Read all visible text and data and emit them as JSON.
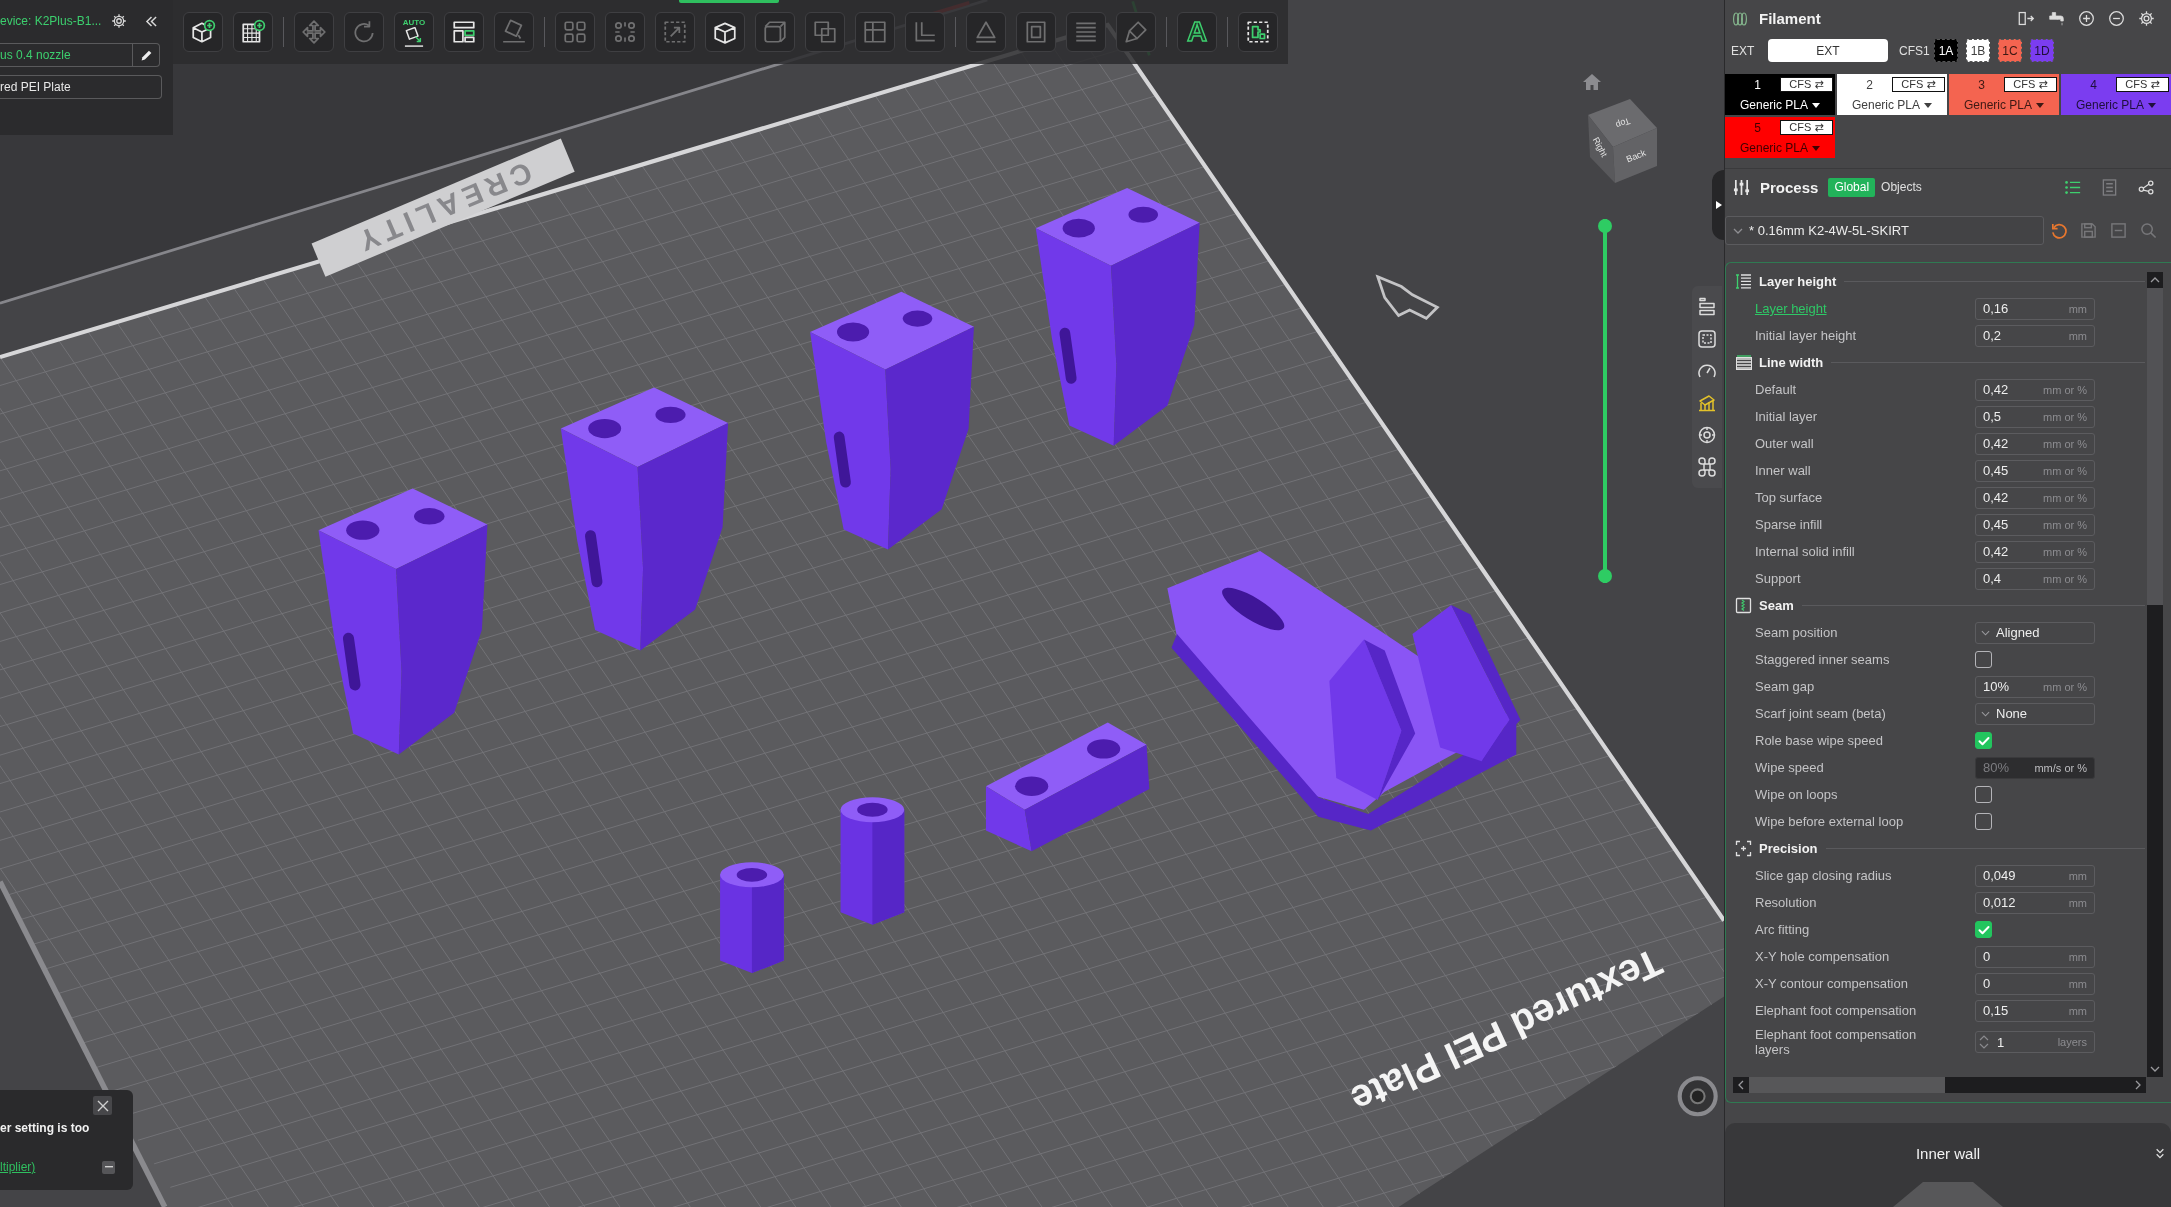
{
  "device_panel": {
    "printer": "evice: K2Plus-B1...",
    "nozzle": "us 0.4 nozzle",
    "plate": "red PEI Plate"
  },
  "toolbar_groups": [
    [
      {
        "kind": "add-model",
        "disabled": false
      },
      {
        "kind": "add-plate",
        "disabled": false
      }
    ],
    [
      {
        "kind": "move",
        "disabled": true
      },
      {
        "kind": "rotate",
        "disabled": true
      },
      {
        "kind": "auto-orient",
        "label": "AUTO",
        "disabled": false
      },
      {
        "kind": "arrange",
        "disabled": false
      },
      {
        "kind": "lay-flat",
        "disabled": true
      }
    ],
    [
      {
        "kind": "split",
        "disabled": true
      },
      {
        "kind": "dots",
        "disabled": true
      },
      {
        "kind": "scale",
        "disabled": true
      },
      {
        "kind": "box",
        "disabled": false
      },
      {
        "kind": "cube",
        "disabled": true
      },
      {
        "kind": "overlap",
        "disabled": true
      },
      {
        "kind": "quartered",
        "disabled": true
      },
      {
        "kind": "corner",
        "disabled": true
      }
    ],
    [
      {
        "kind": "cone",
        "disabled": true
      },
      {
        "kind": "nested",
        "disabled": true
      },
      {
        "kind": "stack",
        "disabled": true
      },
      {
        "kind": "brush",
        "disabled": true
      }
    ],
    [
      {
        "kind": "text",
        "glyph": "A",
        "disabled": false
      }
    ],
    [
      {
        "kind": "puzzle",
        "disabled": false
      }
    ]
  ],
  "scene": {
    "logo": "CREALITY",
    "plate_name": "Textured PEI Plate"
  },
  "view_cube": {
    "labels": [
      "Top",
      "Right",
      "Back"
    ]
  },
  "layer_slider": {
    "level": 1
  },
  "side_tools": [
    {
      "kind": "bars",
      "selected": false
    },
    {
      "kind": "frame",
      "selected": false
    },
    {
      "kind": "gauge",
      "selected": false
    },
    {
      "kind": "support",
      "selected": true
    },
    {
      "kind": "target",
      "selected": false
    },
    {
      "kind": "clover",
      "selected": false
    }
  ],
  "notification": {
    "text": "er setting is too",
    "link": "ltiplier)"
  },
  "filament": {
    "title": "Filament",
    "ext_label": "EXT",
    "ext_value": "EXT",
    "cfs_label": "CFS1",
    "cfs_slots": [
      {
        "label": "1A",
        "color": "#000000"
      },
      {
        "label": "1B",
        "color": "#ffffff"
      },
      {
        "label": "1C",
        "color": "#f46450"
      },
      {
        "label": "1D",
        "color": "#7b3df0"
      }
    ],
    "slots": [
      {
        "number": "1",
        "source": "CFS ⇄",
        "material": "Generic PLA",
        "color": "#000000"
      },
      {
        "number": "2",
        "source": "CFS ⇄",
        "material": "Generic PLA",
        "color": "#ffffff"
      },
      {
        "number": "3",
        "source": "CFS ⇄",
        "material": "Generic PLA",
        "color": "#f46450"
      },
      {
        "number": "4",
        "source": "CFS ⇄",
        "material": "Generic PLA",
        "color": "#7b3df0"
      },
      {
        "number": "5",
        "source": "CFS ⇄",
        "material": "Generic PLA",
        "color": "#ff0000"
      }
    ]
  },
  "process": {
    "title": "Process",
    "tabs": [
      {
        "label": "Global",
        "selected": true
      },
      {
        "label": "Objects",
        "selected": false
      }
    ],
    "preset": "* 0.16mm K2-4W-5L-SKIRT",
    "sections": [
      {
        "title": "Layer height",
        "kind": "layer-height",
        "rows": [
          {
            "label": "Layer height",
            "kind": "number",
            "value": "0,16",
            "unit": "mm",
            "highlighted": true,
            "disabled": false
          },
          {
            "label": "Initial layer height",
            "kind": "number",
            "value": "0,2",
            "unit": "mm",
            "highlighted": false,
            "disabled": false
          }
        ]
      },
      {
        "title": "Line width",
        "kind": "line-width",
        "rows": [
          {
            "label": "Default",
            "kind": "number",
            "value": "0,42",
            "unit": "mm or %",
            "highlighted": false,
            "disabled": false
          },
          {
            "label": "Initial layer",
            "kind": "number",
            "value": "0,5",
            "unit": "mm or %",
            "highlighted": false,
            "disabled": false
          },
          {
            "label": "Outer wall",
            "kind": "number",
            "value": "0,42",
            "unit": "mm or %",
            "highlighted": false,
            "disabled": false
          },
          {
            "label": "Inner wall",
            "kind": "number",
            "value": "0,45",
            "unit": "mm or %",
            "highlighted": false,
            "disabled": false
          },
          {
            "label": "Top surface",
            "kind": "number",
            "value": "0,42",
            "unit": "mm or %",
            "highlighted": false,
            "disabled": false
          },
          {
            "label": "Sparse infill",
            "kind": "number",
            "value": "0,45",
            "unit": "mm or %",
            "highlighted": false,
            "disabled": false
          },
          {
            "label": "Internal solid infill",
            "kind": "number",
            "value": "0,42",
            "unit": "mm or %",
            "highlighted": false,
            "disabled": false
          },
          {
            "label": "Support",
            "kind": "number",
            "value": "0,4",
            "unit": "mm or %",
            "highlighted": false,
            "disabled": false
          }
        ]
      },
      {
        "title": "Seam",
        "kind": "seam",
        "rows": [
          {
            "label": "Seam position",
            "kind": "dropdown",
            "value": "Aligned",
            "highlighted": false,
            "disabled": false
          },
          {
            "label": "Staggered inner seams",
            "kind": "checkbox",
            "checked": false,
            "highlighted": false,
            "disabled": false
          },
          {
            "label": "Seam gap",
            "kind": "number",
            "value": "10%",
            "unit": "mm or %",
            "highlighted": false,
            "disabled": false
          },
          {
            "label": "Scarf joint seam (beta)",
            "kind": "dropdown",
            "value": "None",
            "highlighted": false,
            "disabled": false
          },
          {
            "label": "Role base wipe speed",
            "kind": "checkbox",
            "checked": true,
            "highlighted": false,
            "disabled": false
          },
          {
            "label": "Wipe speed",
            "kind": "number",
            "value": "80%",
            "unit": "mm/s or %",
            "highlighted": false,
            "disabled": true
          },
          {
            "label": "Wipe on loops",
            "kind": "checkbox",
            "checked": false,
            "highlighted": false,
            "disabled": false
          },
          {
            "label": "Wipe before external loop",
            "kind": "checkbox",
            "checked": false,
            "highlighted": false,
            "disabled": false
          }
        ]
      },
      {
        "title": "Precision",
        "kind": "precision",
        "rows": [
          {
            "label": "Slice gap closing radius",
            "kind": "number",
            "value": "0,049",
            "unit": "mm",
            "highlighted": false,
            "disabled": false
          },
          {
            "label": "Resolution",
            "kind": "number",
            "value": "0,012",
            "unit": "mm",
            "highlighted": false,
            "disabled": false
          },
          {
            "label": "Arc fitting",
            "kind": "checkbox",
            "checked": true,
            "highlighted": false,
            "disabled": false
          },
          {
            "label": "X-Y hole compensation",
            "kind": "number",
            "value": "0",
            "unit": "mm",
            "highlighted": false,
            "disabled": false
          },
          {
            "label": "X-Y contour compensation",
            "kind": "number",
            "value": "0",
            "unit": "mm",
            "highlighted": false,
            "disabled": false
          },
          {
            "label": "Elephant foot compensation",
            "kind": "number",
            "value": "0,15",
            "unit": "mm",
            "highlighted": false,
            "disabled": false
          },
          {
            "label": "Elephant foot compensation layers",
            "kind": "spinner",
            "value": "1",
            "unit": "layers",
            "highlighted": false,
            "disabled": false
          }
        ]
      }
    ]
  },
  "preview": {
    "title": "Inner wall"
  }
}
